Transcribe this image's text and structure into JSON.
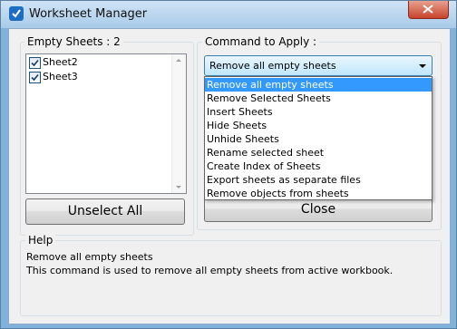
{
  "window": {
    "title": "Worksheet Manager"
  },
  "sheets_panel": {
    "legend": "Empty Sheets : 2",
    "items": [
      {
        "label": "Sheet2",
        "checked": true
      },
      {
        "label": "Sheet3",
        "checked": true
      }
    ],
    "unselect_all_label": "Unselect All"
  },
  "command_panel": {
    "legend": "Command to Apply :",
    "selected": "Remove all empty sheets",
    "options": [
      "Remove all empty sheets",
      "Remove Selected Sheets",
      "Insert Sheets",
      "Hide Sheets",
      "Unhide Sheets",
      "Rename selected sheet",
      "Create Index of Sheets",
      "Export sheets as separate files",
      "Remove objects from sheets"
    ],
    "close_label": "Close"
  },
  "help": {
    "legend": "Help",
    "line1": "Remove all empty sheets",
    "line2": "This command is used to remove all empty sheets from active workbook."
  },
  "colors": {
    "selection": "#3399ff",
    "title_bar": "#a9cbe8",
    "close_button": "#c7432b"
  }
}
